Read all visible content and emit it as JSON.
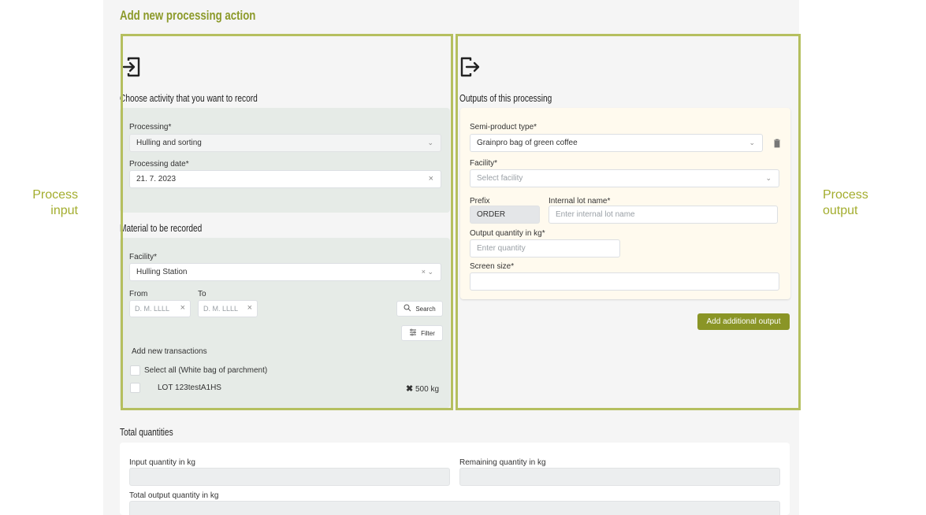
{
  "page": {
    "title": "Add new processing action"
  },
  "annotations": {
    "left": [
      "Process",
      "input"
    ],
    "right": [
      "Process",
      "output"
    ]
  },
  "input": {
    "section_title": "Choose activity that you want to record",
    "processing_label": "Processing*",
    "processing_value": "Hulling and sorting",
    "date_label": "Processing date*",
    "date_value": "21. 7. 2023",
    "clear_symbol": "×",
    "material_title": "Material to be recorded",
    "facility_label": "Facility*",
    "facility_value": "Hulling Station",
    "facility_suffix": "× ⌄",
    "from_label": "From",
    "to_label": "To",
    "from_placeholder": "D. M. LLLL",
    "to_placeholder": "D. M. LLLL",
    "search_label": "Search",
    "filter_label": "Filter",
    "add_transactions": "Add new transactions",
    "select_all": "Select all (White bag of parchment)",
    "lot_name": "LOT 123testA1HS",
    "lot_qty": "500 kg",
    "lot_icon": "✖"
  },
  "output": {
    "section_title": "Outputs of this processing",
    "semi_label": "Semi-product type*",
    "semi_value": "Grainpro bag of green coffee",
    "facility_label": "Facility*",
    "facility_placeholder": "Select facility",
    "prefix_label": "Prefix",
    "prefix_value": "ORDER",
    "lot_label": "Internal lot name*",
    "lot_placeholder": "Enter internal lot name",
    "qty_label": "Output quantity in kg*",
    "qty_placeholder": "Enter quantity",
    "screen_label": "Screen size*",
    "add_button": "Add additional output"
  },
  "totals": {
    "title": "Total quantities",
    "input_label": "Input quantity in kg",
    "remaining_label": "Remaining quantity in kg",
    "total_output_label": "Total output quantity in kg"
  },
  "colors": {
    "accent": "#8a9526",
    "highlight": "#b5bf5f",
    "title": "#8c9a2a"
  }
}
